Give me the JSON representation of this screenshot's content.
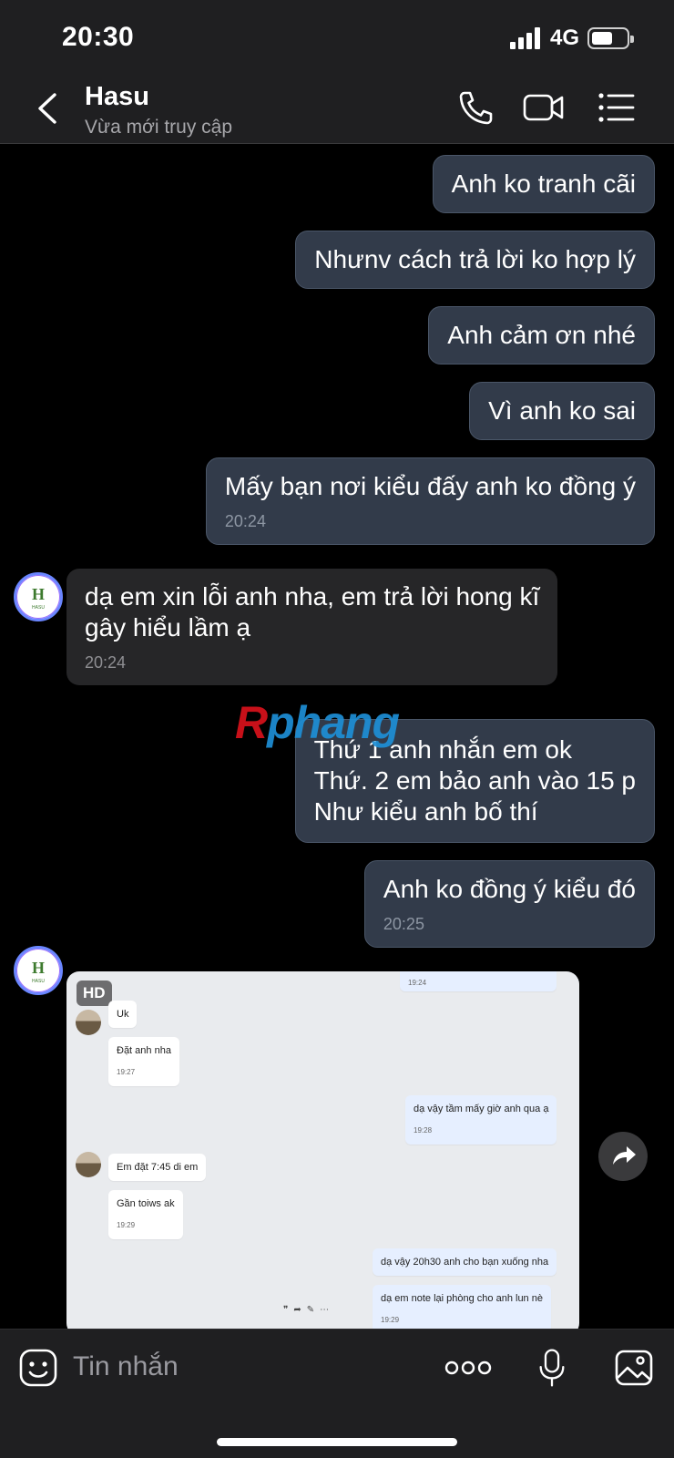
{
  "status_bar": {
    "time": "20:30",
    "network": "4G"
  },
  "header": {
    "contact_name": "Hasu",
    "contact_status": "Vừa mới truy cập",
    "icons": [
      "back-chevron-icon",
      "phone-icon",
      "video-camera-icon",
      "list-menu-icon"
    ]
  },
  "messages": [
    {
      "direction": "out",
      "text": "Anh ko tranh cãi"
    },
    {
      "direction": "out",
      "text": "Nhưnv cách trả lời ko hợp lý"
    },
    {
      "direction": "out",
      "text": "Anh cảm ơn nhé"
    },
    {
      "direction": "out",
      "text": "Vì anh ko sai"
    },
    {
      "direction": "out",
      "text": "Mấy bạn nơi kiểu đấy anh ko đồng ý",
      "time": "20:24"
    },
    {
      "direction": "in",
      "lines": [
        "dạ em xin lỗi anh nha, em trả lời hong kĩ",
        "gây hiểu lầm ạ"
      ],
      "time": "20:24"
    },
    {
      "direction": "out",
      "lines": [
        "Thứ 1 anh nhắn em ok",
        "Thứ. 2 em bảo anh vào 15 p",
        "Như kiểu anh bố thí"
      ]
    },
    {
      "direction": "out",
      "text": "Anh ko đồng ý kiểu đó",
      "time": "20:25"
    }
  ],
  "attachment": {
    "badge": "HD",
    "screenshot_messages": [
      {
        "side": "me",
        "text": "",
        "time": "19:24"
      },
      {
        "side": "them",
        "text": "Uk"
      },
      {
        "side": "them",
        "text": "Đặt anh nha",
        "time": "19:27"
      },
      {
        "side": "me",
        "text": "dạ vậy tầm mấy giờ anh qua ạ",
        "time": "19:28"
      },
      {
        "side": "them",
        "text": "Em đặt 7:45 di em"
      },
      {
        "side": "them",
        "text": "Gần toiws ak",
        "time": "19:29"
      },
      {
        "side": "me",
        "text": "dạ vậy 20h30 anh cho bạn xuống nha"
      },
      {
        "side": "me",
        "text": "dạ em note lại phòng cho anh lun nè",
        "time": "19:29"
      }
    ]
  },
  "watermark": {
    "first": "R",
    "rest": "phang"
  },
  "input_bar": {
    "placeholder": "Tin nhắn",
    "icons": [
      "sticker-icon",
      "more-options-icon",
      "microphone-icon",
      "gallery-icon"
    ]
  },
  "colors": {
    "outgoing_bubble": "#323b4a",
    "incoming_bubble": "#262628",
    "background": "#000000",
    "bar": "#1f1f21"
  }
}
